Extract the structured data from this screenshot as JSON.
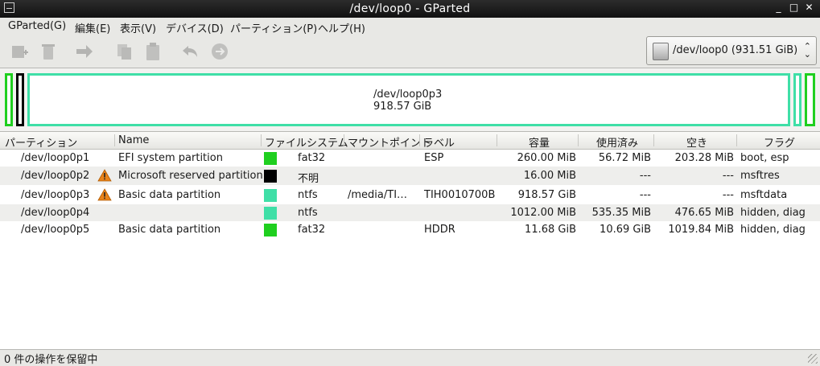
{
  "window": {
    "title": "/dev/loop0 - GParted",
    "controls": [
      "_",
      "□",
      "✕"
    ]
  },
  "menu": [
    "GParted(G)",
    "編集(E)",
    "表示(V)",
    "デバイス(D)",
    "パーティション(P)",
    "ヘルプ(H)"
  ],
  "toolbar": {
    "icons": [
      "new-partition-icon",
      "delete-icon",
      "resize-move-icon",
      "copy-icon",
      "paste-icon",
      "undo-icon",
      "apply-icon"
    ]
  },
  "device": {
    "label": "/dev/loop0  (931.51 GiB)",
    "arrows": "⌃\n⌄"
  },
  "map": {
    "name": "/dev/loop0p3",
    "size": "918.57 GiB"
  },
  "columns": [
    "パーティション",
    "Name",
    "ファイルシステム",
    "マウントポイント",
    "ラベル",
    "容量",
    "使用済み",
    "空き",
    "フラグ"
  ],
  "rows": [
    {
      "partition": "/dev/loop0p1",
      "warning": false,
      "name": "EFI system partition",
      "fs_color": "#1fcf1f",
      "fs": "fat32",
      "mount": "",
      "label": "ESP",
      "size": "260.00 MiB",
      "used": "56.72 MiB",
      "free": "203.28 MiB",
      "flags": "boot, esp"
    },
    {
      "partition": "/dev/loop0p2",
      "warning": true,
      "name": "Microsoft reserved partition",
      "fs_color": "#000000",
      "fs": "不明",
      "mount": "",
      "label": "",
      "size": "16.00 MiB",
      "used": "---",
      "free": "---",
      "flags": "msftres"
    },
    {
      "partition": "/dev/loop0p3",
      "warning": true,
      "name": "Basic data partition",
      "fs_color": "#3fdfa7",
      "fs": "ntfs",
      "mount": "/media/TI…",
      "label": "TIH0010700B",
      "size": "918.57 GiB",
      "used": "---",
      "free": "---",
      "flags": "msftdata"
    },
    {
      "partition": "/dev/loop0p4",
      "warning": false,
      "name": "",
      "fs_color": "#3fdfa7",
      "fs": "ntfs",
      "mount": "",
      "label": "",
      "size": "1012.00 MiB",
      "used": "535.35 MiB",
      "free": "476.65 MiB",
      "flags": "hidden, diag"
    },
    {
      "partition": "/dev/loop0p5",
      "warning": false,
      "name": "Basic data partition",
      "fs_color": "#1fcf1f",
      "fs": "fat32",
      "mount": "",
      "label": "HDDR",
      "size": "11.68 GiB",
      "used": "10.69 GiB",
      "free": "1019.84 MiB",
      "flags": "hidden, diag"
    }
  ],
  "status": "0 件の操作を保留中",
  "colors": {
    "fat32": "#1fcf1f",
    "ntfs": "#3fdfa7",
    "unknown": "#000000",
    "warning": "#e8831a"
  }
}
